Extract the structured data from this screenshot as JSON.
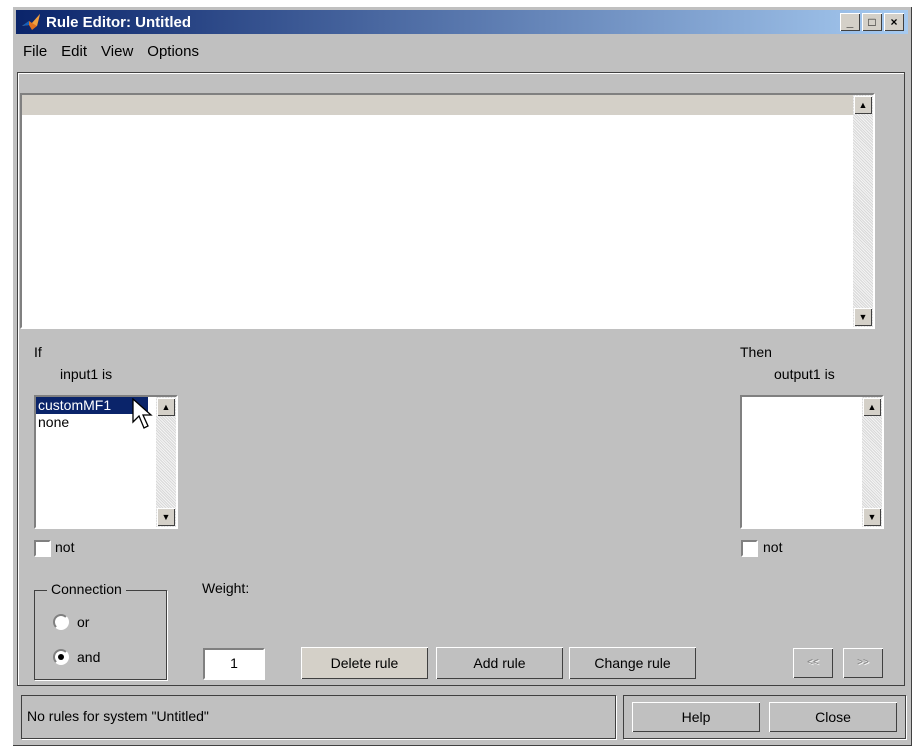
{
  "window": {
    "title": "Rule Editor: Untitled",
    "minimize": "_",
    "maximize": "□",
    "close": "×"
  },
  "menu": [
    "File",
    "Edit",
    "View",
    "Options"
  ],
  "if_label": "If",
  "input": {
    "label": "input1 is",
    "items": [
      "customMF1",
      "none"
    ],
    "selected": "customMF1",
    "not_label": "not"
  },
  "then_label": "Then",
  "output": {
    "label": "output1 is",
    "items": [],
    "not_label": "not"
  },
  "connection": {
    "label": "Connection",
    "options": [
      "or",
      "and"
    ],
    "selected": "and"
  },
  "weight": {
    "label": "Weight:",
    "value": "1"
  },
  "buttons": {
    "delete": "Delete rule",
    "add": "Add rule",
    "change": "Change rule",
    "prev": "<<",
    "next": ">>"
  },
  "status": "No rules for system \"Untitled\"",
  "help": "Help",
  "close": "Close",
  "icons": {
    "app": "matlab-logo-icon",
    "scroll_up": "arrow-up-icon",
    "scroll_down": "arrow-down-icon"
  }
}
